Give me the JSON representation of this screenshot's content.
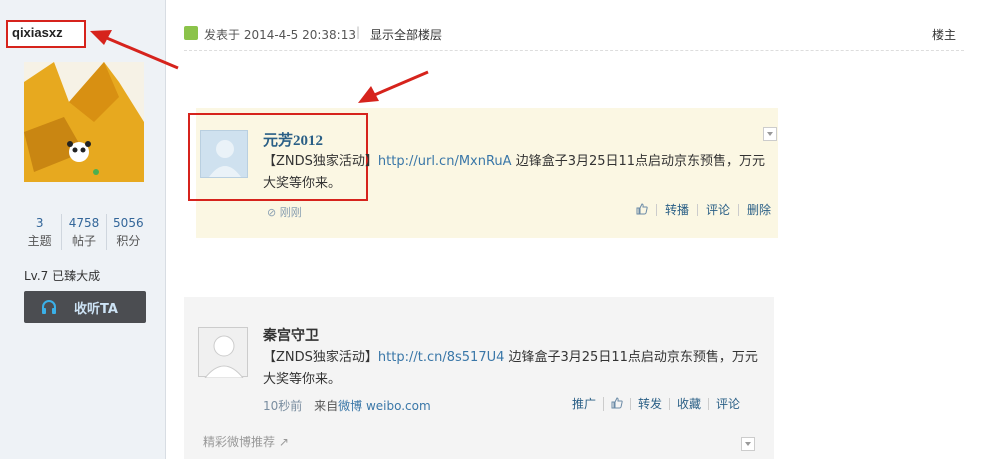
{
  "post_title_partial": "【ZNDS独家活动】边锋盒子3月25日11点启动京东预售，万元大奖等你来",
  "author": {
    "username": "qixiasxz",
    "stats": [
      {
        "value": "3",
        "label": "主题"
      },
      {
        "value": "4758",
        "label": "帖子"
      },
      {
        "value": "5056",
        "label": "积分"
      }
    ],
    "level": "Lv.7 已臻大成",
    "follow_label": "收听TA"
  },
  "post_meta": {
    "posted": "发表于 2014-4-5 20:38:13",
    "separator": "|",
    "show_all": "显示全部楼层",
    "floor": "楼主"
  },
  "weibo1": {
    "name": "元芳2012",
    "text_prefix": "【ZNDS独家活动】",
    "link": "http://url.cn/MxnRuA",
    "text_suffix": " 边锋盒子3月25日11点启动京东预售，万元大奖等你来。",
    "time": "刚刚",
    "actions": [
      "转播",
      "评论",
      "删除"
    ]
  },
  "weibo2": {
    "name": "秦宫守卫",
    "text_prefix": "【ZNDS独家活动】",
    "link": "http://t.cn/8s517U4",
    "text_suffix": " 边锋盒子3月25日11点启动京东预售，万元大奖等你来。",
    "time": "10秒前",
    "source_prefix": "来自",
    "source_link": "微博 weibo.com",
    "actions": [
      "推广",
      "转发",
      "收藏",
      "评论"
    ],
    "recommend": "精彩微博推荐"
  },
  "colors": {
    "annotation_red": "#d6231c",
    "link_blue": "#3a77a8"
  }
}
